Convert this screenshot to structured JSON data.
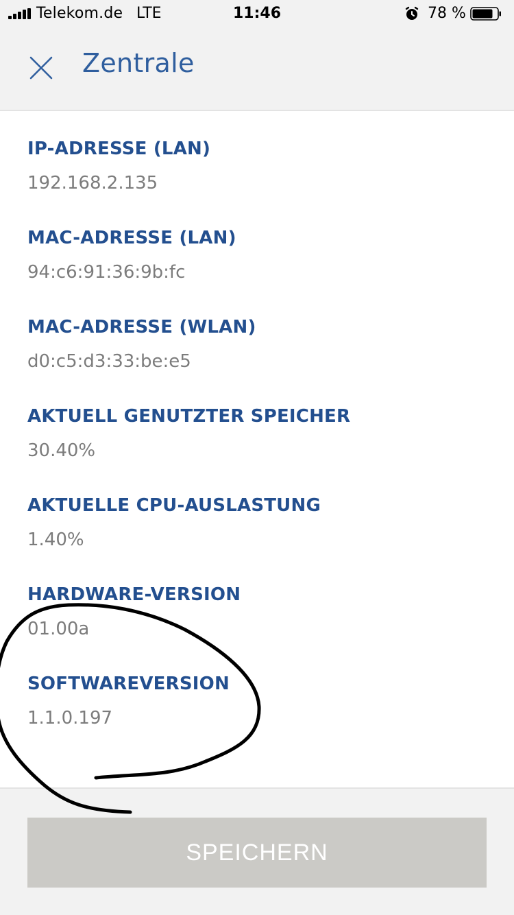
{
  "status_bar": {
    "carrier": "Telekom.de",
    "network": "LTE",
    "time": "11:46",
    "battery_percent": "78 %",
    "icons": [
      "signal-icon",
      "alarm-icon",
      "battery-icon"
    ]
  },
  "header": {
    "title": "Zentrale",
    "close_icon": "close-icon"
  },
  "info": {
    "items": [
      {
        "label": "IP-ADRESSE (LAN)",
        "value": "192.168.2.135"
      },
      {
        "label": "MAC-ADRESSE (LAN)",
        "value": "94:c6:91:36:9b:fc"
      },
      {
        "label": "MAC-ADRESSE (WLAN)",
        "value": "d0:c5:d3:33:be:e5"
      },
      {
        "label": "AKTUELL GENUTZTER SPEICHER",
        "value": "30.40%"
      },
      {
        "label": "AKTUELLE CPU-AUSLASTUNG",
        "value": "1.40%"
      },
      {
        "label": "HARDWARE-VERSION",
        "value": "01.00a"
      },
      {
        "label": "SOFTWAREVERSION",
        "value": "1.1.0.197"
      }
    ]
  },
  "footer": {
    "save_label": "SPEICHERN"
  },
  "colors": {
    "label": "#234f8f",
    "title": "#2f5e9e",
    "value": "#7c7c7c",
    "header_bg": "#f2f2f2",
    "button_bg": "#cbcac6",
    "annotation": "#000000"
  }
}
